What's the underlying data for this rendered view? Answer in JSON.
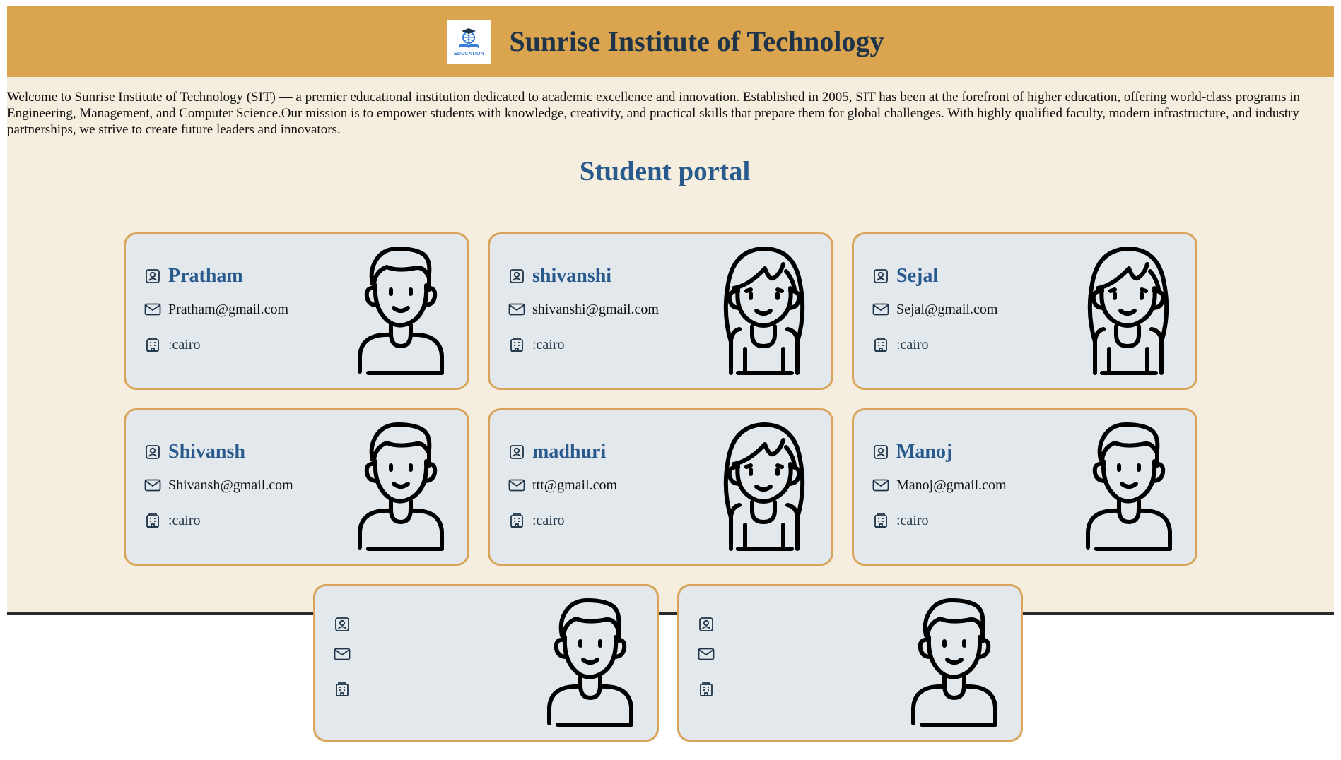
{
  "header": {
    "logo_text": "EDUCATION",
    "title": "Sunrise Institute of Technology"
  },
  "intro": "Welcome to Sunrise Institute of Technology (SIT) — a premier educational institution dedicated to academic excellence and innovation. Established in 2005, SIT has been at the forefront of higher education, offering world-class programs in Engineering, Management, and Computer Science.Our mission is to empower students with knowledge, creativity, and practical skills that prepare them for global challenges. With highly qualified faculty, modern infrastructure, and industry partnerships, we strive to create future leaders and innovators.",
  "portal_title": "Student portal",
  "students": [
    {
      "name": "Pratham",
      "email": "Pratham@gmail.com",
      "location": ":cairo",
      "avatar": "boy-avatar-icon"
    },
    {
      "name": "shivanshi",
      "email": "shivanshi@gmail.com",
      "location": ":cairo",
      "avatar": "girl-avatar-icon"
    },
    {
      "name": "Sejal",
      "email": "Sejal@gmail.com",
      "location": ":cairo",
      "avatar": "girl-avatar-icon"
    },
    {
      "name": "Shivansh",
      "email": "Shivansh@gmail.com",
      "location": ":cairo",
      "avatar": "boy-avatar-icon"
    },
    {
      "name": "madhuri",
      "email": "ttt@gmail.com",
      "location": ":cairo",
      "avatar": "girl-avatar-icon"
    },
    {
      "name": "Manoj",
      "email": "Manoj@gmail.com",
      "location": ":cairo",
      "avatar": "boy-avatar-icon"
    },
    {
      "name": "",
      "email": "",
      "location": "",
      "avatar": "avatar-icon"
    },
    {
      "name": "",
      "email": "",
      "location": "",
      "avatar": "avatar-icon"
    }
  ],
  "colors": {
    "header_bg": "#dba550",
    "page_bg": "#f5eddd",
    "card_bg": "#e3e8ed",
    "card_border": "#d9a45a",
    "accent_text": "#285a8e",
    "title_text": "#1f3448"
  }
}
